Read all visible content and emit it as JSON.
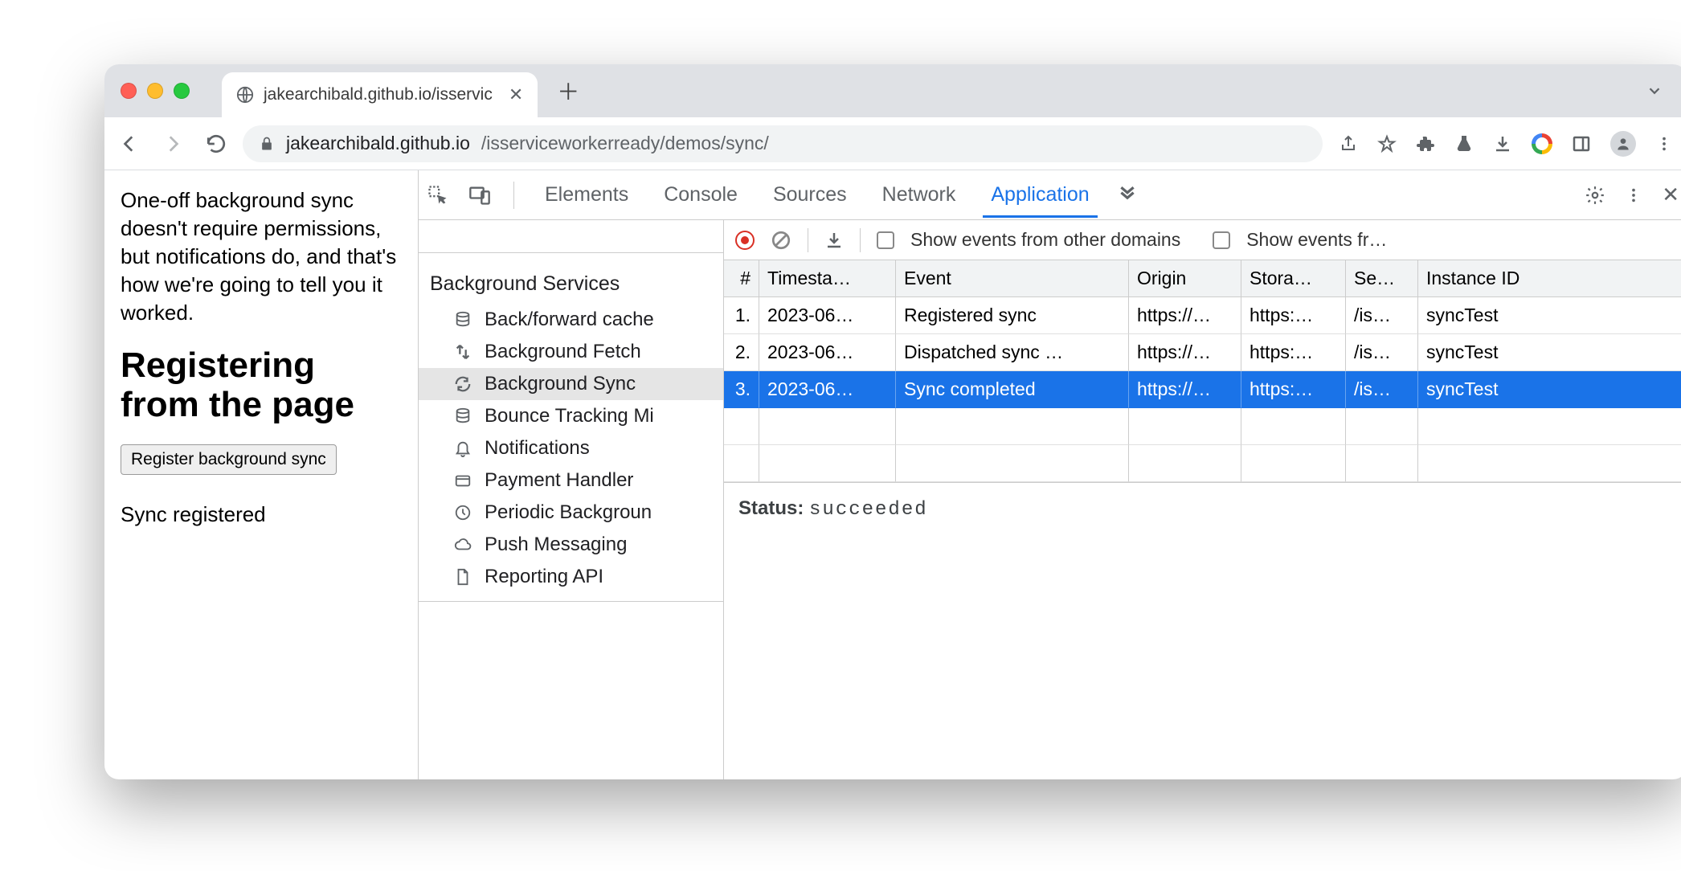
{
  "browser_tab": {
    "title": "jakearchibald.github.io/isservic"
  },
  "address": {
    "host": "jakearchibald.github.io",
    "path": "/isserviceworkerready/demos/sync/"
  },
  "page": {
    "intro": "One-off background sync doesn't require permissions, but notifications do, and that's how we're going to tell you it worked.",
    "heading": "Registering from the page",
    "button_label": "Register background sync",
    "status": "Sync registered"
  },
  "devtools": {
    "tabs": [
      "Elements",
      "Console",
      "Sources",
      "Network",
      "Application"
    ],
    "active_tab": "Application",
    "sidebar_heading": "Background Services",
    "sidebar_items": [
      {
        "icon": "database",
        "label": "Back/forward cache"
      },
      {
        "icon": "transfer",
        "label": "Background Fetch"
      },
      {
        "icon": "sync",
        "label": "Background Sync",
        "selected": true
      },
      {
        "icon": "database",
        "label": "Bounce Tracking Mi"
      },
      {
        "icon": "bell",
        "label": "Notifications"
      },
      {
        "icon": "card",
        "label": "Payment Handler"
      },
      {
        "icon": "clock",
        "label": "Periodic Backgroun"
      },
      {
        "icon": "cloud",
        "label": "Push Messaging"
      },
      {
        "icon": "file",
        "label": "Reporting API"
      }
    ],
    "toolbar": {
      "show_other": "Show events from other domains",
      "show_fr": "Show events fr…"
    },
    "columns": [
      "#",
      "Timesta…",
      "Event",
      "Origin",
      "Stora…",
      "Se…",
      "Instance ID"
    ],
    "rows": [
      {
        "n": "1.",
        "ts": "2023-06…",
        "ev": "Registered sync",
        "or": "https://…",
        "st": "https:…",
        "se": "/is…",
        "id": "syncTest"
      },
      {
        "n": "2.",
        "ts": "2023-06…",
        "ev": "Dispatched sync …",
        "or": "https://…",
        "st": "https:…",
        "se": "/is…",
        "id": "syncTest"
      },
      {
        "n": "3.",
        "ts": "2023-06…",
        "ev": "Sync completed",
        "or": "https://…",
        "st": "https:…",
        "se": "/is…",
        "id": "syncTest",
        "selected": true
      }
    ],
    "status_label": "Status:",
    "status_value": "succeeded"
  }
}
